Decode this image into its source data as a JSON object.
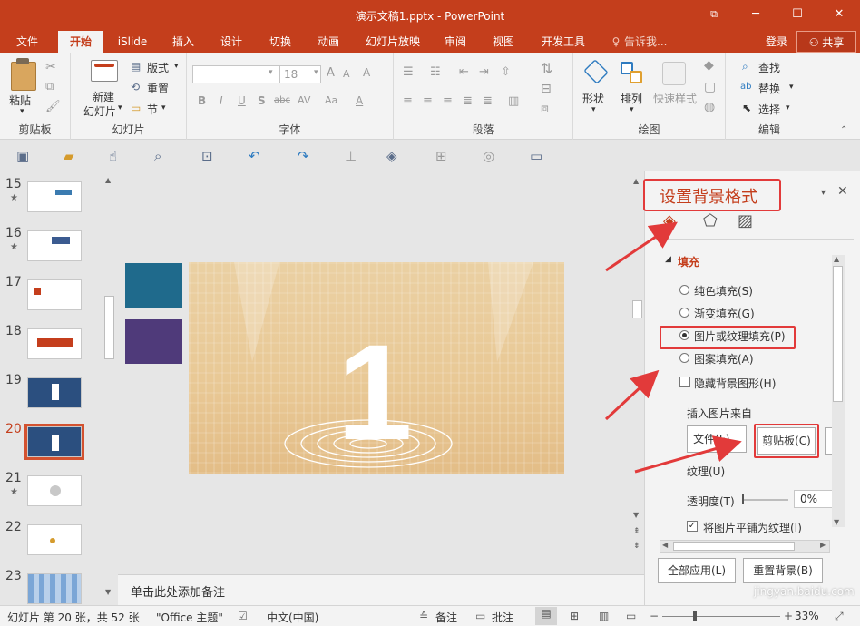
{
  "window": {
    "title": "演示文稿1.pptx - PowerPoint",
    "restore_icon": "ribbon-display-icon",
    "min_label": "─",
    "max_label": "☐",
    "close_label": "✕"
  },
  "tabs": [
    "文件",
    "开始",
    "iSlide",
    "插入",
    "设计",
    "切换",
    "动画",
    "幻灯片放映",
    "审阅",
    "视图",
    "开发工具"
  ],
  "active_tab": "开始",
  "tellme": "告诉我...",
  "signin": "登录",
  "share": "共享",
  "ribbon": {
    "clipboard": {
      "label": "剪贴板",
      "paste": "粘贴"
    },
    "slides": {
      "label": "幻灯片",
      "new_slide_line1": "新建",
      "new_slide_line2": "幻灯片",
      "layout": "版式",
      "reset": "重置",
      "section": "节"
    },
    "font": {
      "label": "字体",
      "font_name": "",
      "font_size": "18",
      "bold": "B",
      "italic": "I",
      "underline": "U",
      "shadow": "S",
      "strike": "abc",
      "spacing": "AV",
      "case": "Aa",
      "color": "A"
    },
    "paragraph": {
      "label": "段落"
    },
    "drawing": {
      "label": "绘图",
      "shape": "形状",
      "arrange": "排列",
      "quick_styles": "快速样式"
    },
    "editing": {
      "label": "编辑",
      "find": "查找",
      "replace": "替换",
      "select": "选择"
    }
  },
  "slides_panel": [
    {
      "num": "15",
      "star": true
    },
    {
      "num": "16",
      "star": true
    },
    {
      "num": "17",
      "star": false
    },
    {
      "num": "18",
      "star": false
    },
    {
      "num": "19",
      "star": false
    },
    {
      "num": "20",
      "star": false,
      "selected": true
    },
    {
      "num": "21",
      "star": true
    },
    {
      "num": "22",
      "star": false
    },
    {
      "num": "23",
      "star": false
    }
  ],
  "slide": {
    "number_text": "1"
  },
  "notes_placeholder": "单击此处添加备注",
  "pane": {
    "title": "设置背景格式",
    "fill_section": "填充",
    "options": [
      "纯色填充(S)",
      "渐变填充(G)",
      "图片或纹理填充(P)",
      "图案填充(A)"
    ],
    "selected_option": "图片或纹理填充(P)",
    "hide_bg": "隐藏背景图形(H)",
    "insert_from": "插入图片来自",
    "file_btn": "文件(F)...",
    "clipboard_btn": "剪贴板(C)",
    "texture": "纹理(U)",
    "transparency_label": "透明度(T)",
    "transparency_value": "0%",
    "tile_checkbox": "将图片平铺为纹理(I)",
    "apply_all": "全部应用(L)",
    "reset_bg": "重置背景(B)"
  },
  "status": {
    "slide_info": "幻灯片 第 20 张，共 52 张",
    "theme": "\"Office 主题\"",
    "language": "中文(中国)",
    "notes": "备注",
    "comments": "批注",
    "zoom": "33%"
  },
  "watermark": "jingyan.baidu.com",
  "colors": {
    "brand": "#c43e1c",
    "annotation_red": "#e23a3a",
    "slide_teal": "#1f6a8c",
    "slide_purple": "#4f3a7a"
  }
}
